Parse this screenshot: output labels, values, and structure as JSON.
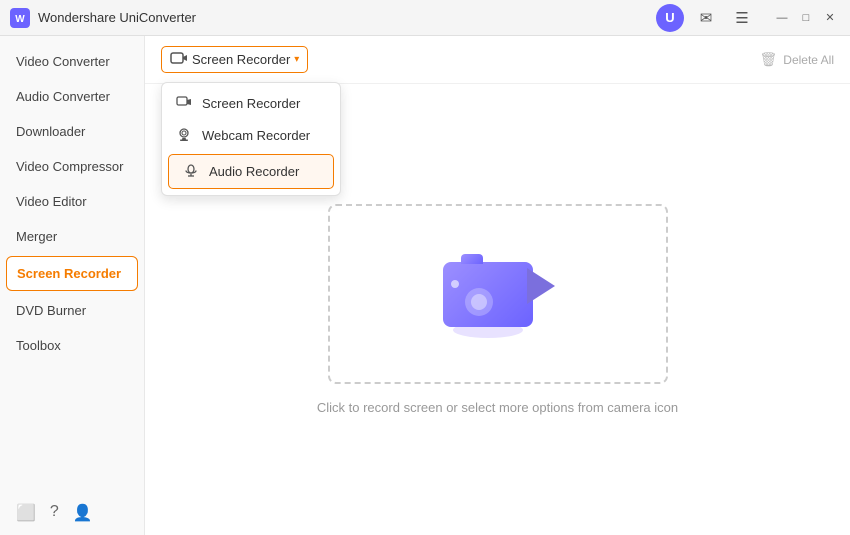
{
  "app": {
    "title": "Wondershare UniConverter",
    "logo_text": "W"
  },
  "title_bar": {
    "icons": {
      "avatar": "U",
      "email": "✉",
      "menu": "☰",
      "minimize": "—",
      "maximize": "□",
      "close": "✕"
    }
  },
  "sidebar": {
    "items": [
      {
        "id": "video-converter",
        "label": "Video Converter",
        "active": false
      },
      {
        "id": "audio-converter",
        "label": "Audio Converter",
        "active": false
      },
      {
        "id": "downloader",
        "label": "Downloader",
        "active": false
      },
      {
        "id": "video-compressor",
        "label": "Video Compressor",
        "active": false
      },
      {
        "id": "video-editor",
        "label": "Video Editor",
        "active": false
      },
      {
        "id": "merger",
        "label": "Merger",
        "active": false
      },
      {
        "id": "screen-recorder",
        "label": "Screen Recorder",
        "active": true
      },
      {
        "id": "dvd-burner",
        "label": "DVD Burner",
        "active": false
      },
      {
        "id": "toolbox",
        "label": "Toolbox",
        "active": false
      }
    ],
    "bottom_icons": [
      "⬜",
      "?",
      "👤"
    ]
  },
  "toolbar": {
    "recorder_button": "Screen Recorder",
    "delete_all": "Delete All"
  },
  "dropdown": {
    "items": [
      {
        "id": "screen-recorder",
        "label": "Screen Recorder",
        "icon": "▭"
      },
      {
        "id": "webcam-recorder",
        "label": "Webcam Recorder",
        "icon": "◎"
      },
      {
        "id": "audio-recorder",
        "label": "Audio Recorder",
        "icon": "◉",
        "highlighted": true
      }
    ]
  },
  "center": {
    "hint": "Click to record screen or select more options from camera icon"
  }
}
